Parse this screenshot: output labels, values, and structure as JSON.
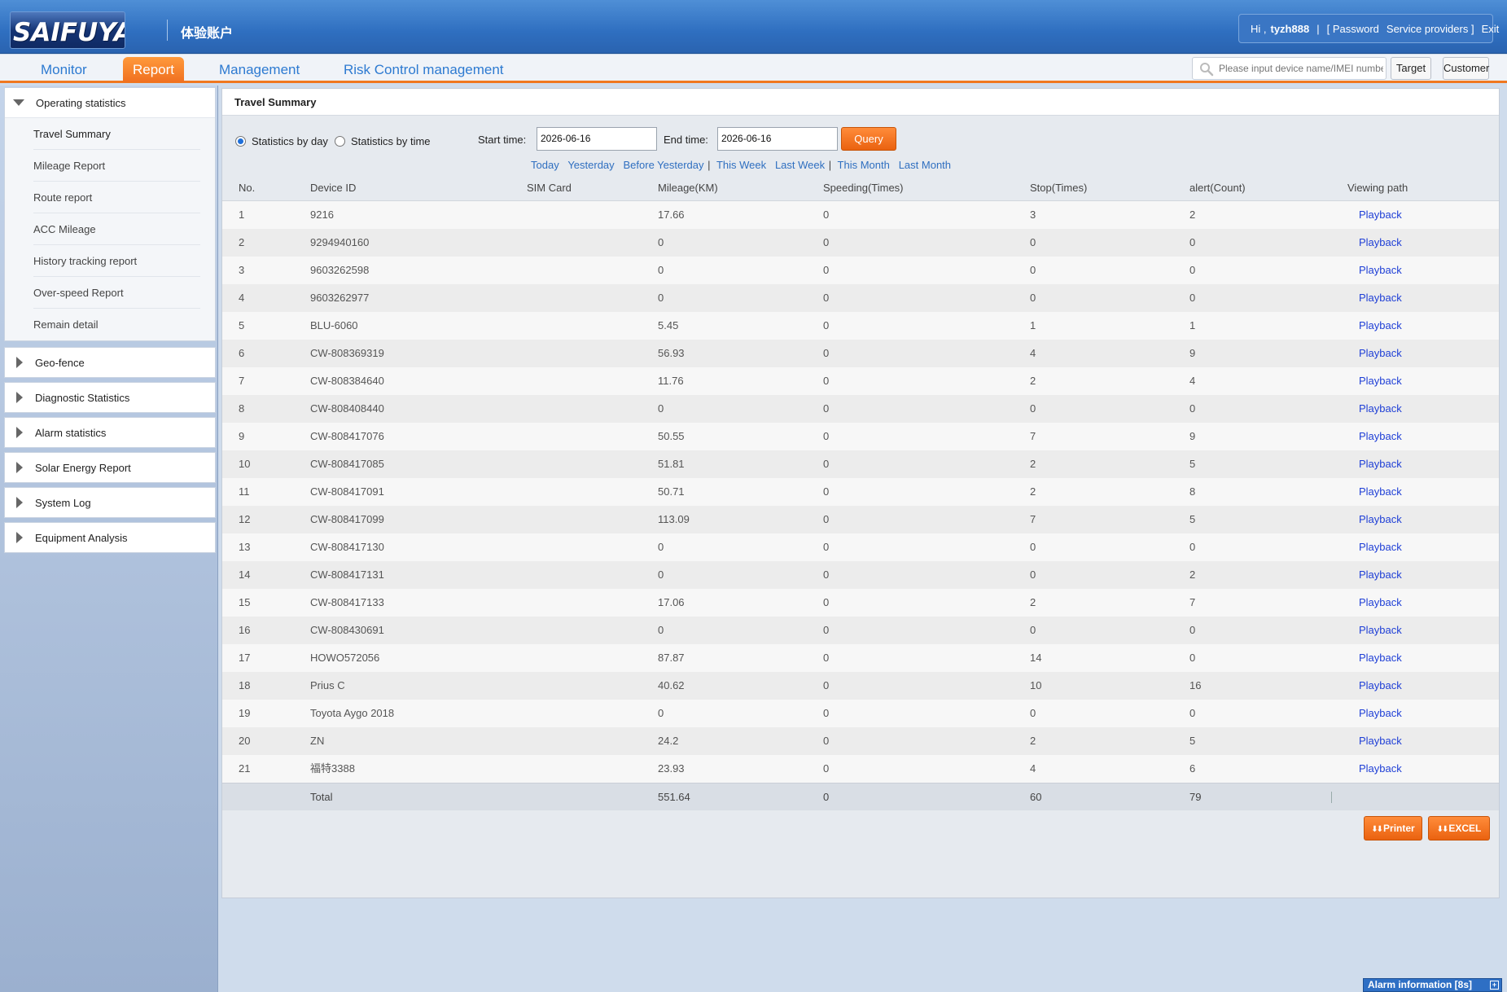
{
  "header": {
    "logo_text": "SAIFUYA",
    "account_name": "体验账户",
    "greeting": "Hi ,",
    "username": "tyzh888",
    "divider": "|",
    "password_link": "[ Password",
    "service_link": "Service providers ]",
    "exit_link": "Exit"
  },
  "nav": {
    "tabs": [
      "Monitor",
      "Report",
      "Management",
      "Risk Control management"
    ],
    "active_tab": "Report",
    "search_placeholder": "Please input device name/IMEI number",
    "target_button": "Target",
    "customer_button": "Customer"
  },
  "sidebar": {
    "groups": [
      {
        "title": "Operating statistics",
        "expanded": true,
        "items": [
          "Travel Summary",
          "Mileage Report",
          "Route report",
          "ACC Mileage",
          "History tracking report",
          "Over-speed Report",
          "Remain detail"
        ]
      },
      {
        "title": "Geo-fence",
        "expanded": false
      },
      {
        "title": "Diagnostic Statistics",
        "expanded": false
      },
      {
        "title": "Alarm statistics",
        "expanded": false
      },
      {
        "title": "Solar Energy Report",
        "expanded": false
      },
      {
        "title": "System Log",
        "expanded": false
      },
      {
        "title": "Equipment Analysis",
        "expanded": false
      }
    ],
    "active_item": "Travel Summary"
  },
  "main": {
    "title": "Travel Summary",
    "filter": {
      "by_day_label": "Statistics by day",
      "by_time_label": "Statistics by time",
      "selected": "Statistics by day",
      "start_label": "Start time:",
      "start_value": "2026-06-16",
      "end_label": "End time:",
      "end_value": "2026-06-16",
      "query_button": "Query",
      "quick_links": [
        "Today",
        "Yesterday",
        "Before Yesterday",
        "This Week",
        "Last Week",
        "This Month",
        "Last Month"
      ],
      "quick_sep": "|"
    },
    "table": {
      "columns": [
        "No.",
        "Device ID",
        "SIM Card",
        "Mileage(KM)",
        "Speeding(Times)",
        "Stop(Times)",
        "alert(Count)",
        "Viewing path"
      ],
      "playback_label": "Playback",
      "rows": [
        [
          "1",
          "9216",
          "",
          "17.66",
          "0",
          "3",
          "2"
        ],
        [
          "2",
          "9294940160",
          "",
          "0",
          "0",
          "0",
          "0"
        ],
        [
          "3",
          "9603262598",
          "",
          "0",
          "0",
          "0",
          "0"
        ],
        [
          "4",
          "9603262977",
          "",
          "0",
          "0",
          "0",
          "0"
        ],
        [
          "5",
          "BLU-6060",
          "",
          "5.45",
          "0",
          "1",
          "1"
        ],
        [
          "6",
          "CW-808369319",
          "",
          "56.93",
          "0",
          "4",
          "9"
        ],
        [
          "7",
          "CW-808384640",
          "",
          "11.76",
          "0",
          "2",
          "4"
        ],
        [
          "8",
          "CW-808408440",
          "",
          "0",
          "0",
          "0",
          "0"
        ],
        [
          "9",
          "CW-808417076",
          "",
          "50.55",
          "0",
          "7",
          "9"
        ],
        [
          "10",
          "CW-808417085",
          "",
          "51.81",
          "0",
          "2",
          "5"
        ],
        [
          "11",
          "CW-808417091",
          "",
          "50.71",
          "0",
          "2",
          "8"
        ],
        [
          "12",
          "CW-808417099",
          "",
          "113.09",
          "0",
          "7",
          "5"
        ],
        [
          "13",
          "CW-808417130",
          "",
          "0",
          "0",
          "0",
          "0"
        ],
        [
          "14",
          "CW-808417131",
          "",
          "0",
          "0",
          "0",
          "2"
        ],
        [
          "15",
          "CW-808417133",
          "",
          "17.06",
          "0",
          "2",
          "7"
        ],
        [
          "16",
          "CW-808430691",
          "",
          "0",
          "0",
          "0",
          "0"
        ],
        [
          "17",
          "HOWO572056",
          "",
          "87.87",
          "0",
          "14",
          "0"
        ],
        [
          "18",
          "Prius C",
          "",
          "40.62",
          "0",
          "10",
          "16"
        ],
        [
          "19",
          "Toyota Aygo 2018",
          "",
          "0",
          "0",
          "0",
          "0"
        ],
        [
          "20",
          "ZN",
          "",
          "24.2",
          "0",
          "2",
          "5"
        ],
        [
          "21",
          "福特3388",
          "",
          "23.93",
          "0",
          "4",
          "6"
        ]
      ],
      "total": {
        "label": "Total",
        "mileage": "551.64",
        "speeding": "0",
        "stop": "60",
        "alert": "79"
      }
    },
    "printer_button": "Printer",
    "excel_button": "EXCEL"
  },
  "alarm_bar": {
    "label": "Alarm information [8s]"
  },
  "colors": {
    "accent_orange": "#f07820",
    "header_blue": "#2f6fc0",
    "link_blue": "#1f3fd6"
  }
}
